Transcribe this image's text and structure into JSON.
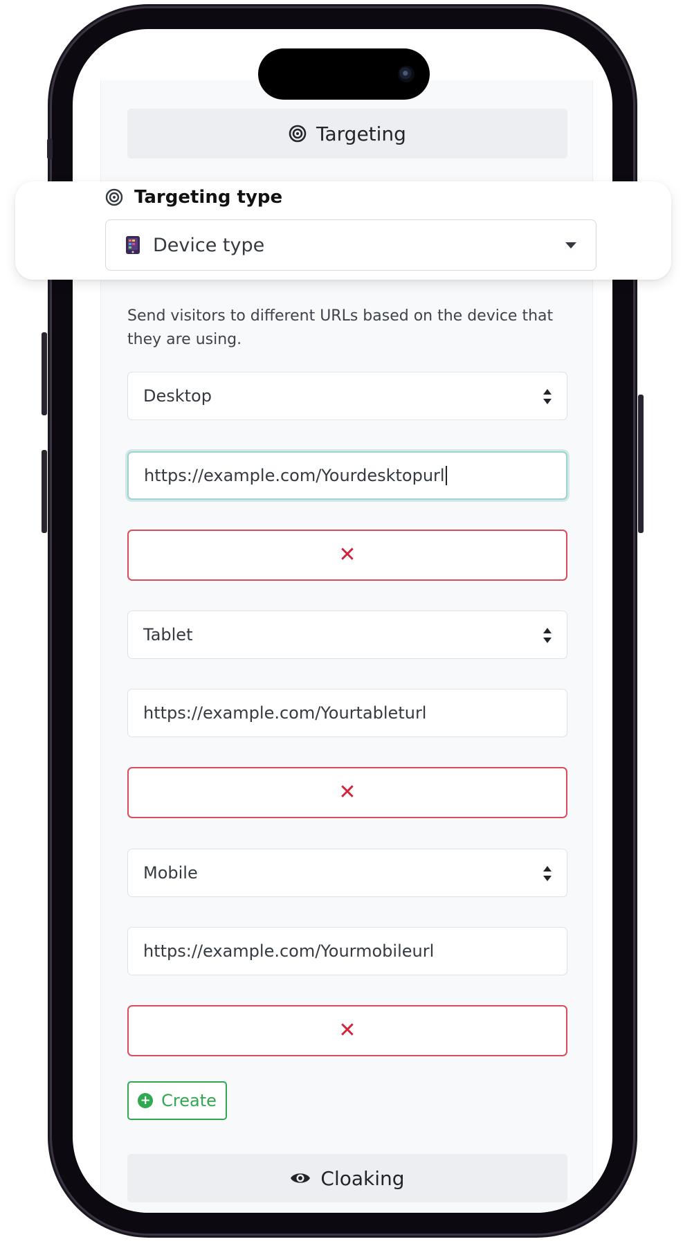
{
  "section_targeting": {
    "label": "Targeting",
    "icon": "target-icon"
  },
  "targeting_type": {
    "label": "Targeting type",
    "icon": "target-icon",
    "selected": "Device type",
    "selected_icon": "device-icon"
  },
  "description": "Send visitors to different URLs based on the device that they are using.",
  "rules": [
    {
      "device": "Desktop",
      "url": "https://example.com/Yourdesktopurl",
      "remove_icon": "close-icon"
    },
    {
      "device": "Tablet",
      "url": "https://example.com/Yourtableturl",
      "remove_icon": "close-icon"
    },
    {
      "device": "Mobile",
      "url": "https://example.com/Yourmobileurl",
      "remove_icon": "close-icon"
    }
  ],
  "create_button": {
    "label": "Create",
    "icon": "plus-circle-icon",
    "color": "#2fa84f"
  },
  "section_cloaking": {
    "label": "Cloaking",
    "icon": "eye-icon"
  },
  "colors": {
    "danger": "#d0243a",
    "success": "#2fa84f",
    "focus": "#9fd3d1"
  }
}
